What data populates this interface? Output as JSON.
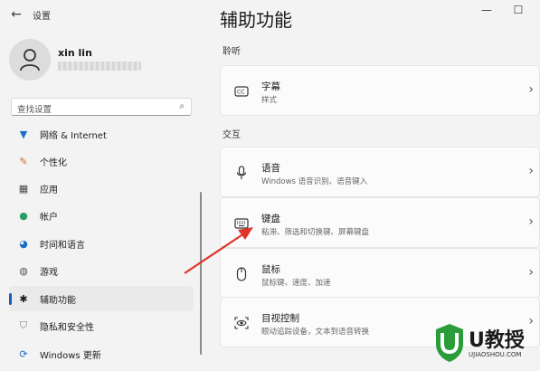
{
  "window": {
    "title": "设置",
    "back_glyph": "←",
    "minimize_glyph": "—",
    "maximize_glyph": "☐"
  },
  "profile": {
    "name": "xin lin"
  },
  "search": {
    "placeholder": "查找设置"
  },
  "nav": {
    "items": [
      {
        "label": "网络 & Internet",
        "icon": "wifi-icon"
      },
      {
        "label": "个性化",
        "icon": "brush-icon"
      },
      {
        "label": "应用",
        "icon": "apps-icon"
      },
      {
        "label": "帐户",
        "icon": "person-icon"
      },
      {
        "label": "时间和语言",
        "icon": "globe-clock-icon"
      },
      {
        "label": "游戏",
        "icon": "gamepad-icon"
      },
      {
        "label": "辅助功能",
        "icon": "accessibility-icon",
        "active": true
      },
      {
        "label": "隐私和安全性",
        "icon": "shield-icon"
      },
      {
        "label": "Windows 更新",
        "icon": "update-icon"
      }
    ]
  },
  "main": {
    "title": "辅助功能",
    "sections": [
      {
        "label": "聆听"
      },
      {
        "label": "交互"
      }
    ],
    "cards": [
      {
        "title": "字幕",
        "subtitle": "样式",
        "icon": "captions-icon"
      },
      {
        "title": "语音",
        "subtitle": "Windows 语音识别、语音键入",
        "icon": "microphone-icon"
      },
      {
        "title": "键盘",
        "subtitle": "粘滞、筛选和切换键、屏幕键盘",
        "icon": "keyboard-icon"
      },
      {
        "title": "鼠标",
        "subtitle": "鼠标键、速度、加速",
        "icon": "mouse-icon"
      },
      {
        "title": "目视控制",
        "subtitle": "眼动追踪设备，文本到语音转换",
        "icon": "eye-control-icon"
      }
    ],
    "chevron": "›"
  },
  "colors": {
    "accent": "#1a5fb4",
    "arrow": "#e0352b",
    "watermark_green": "#2a9d3a"
  },
  "watermark": {
    "brand": "U教授",
    "url": "UJIAOSHOU.COM"
  }
}
